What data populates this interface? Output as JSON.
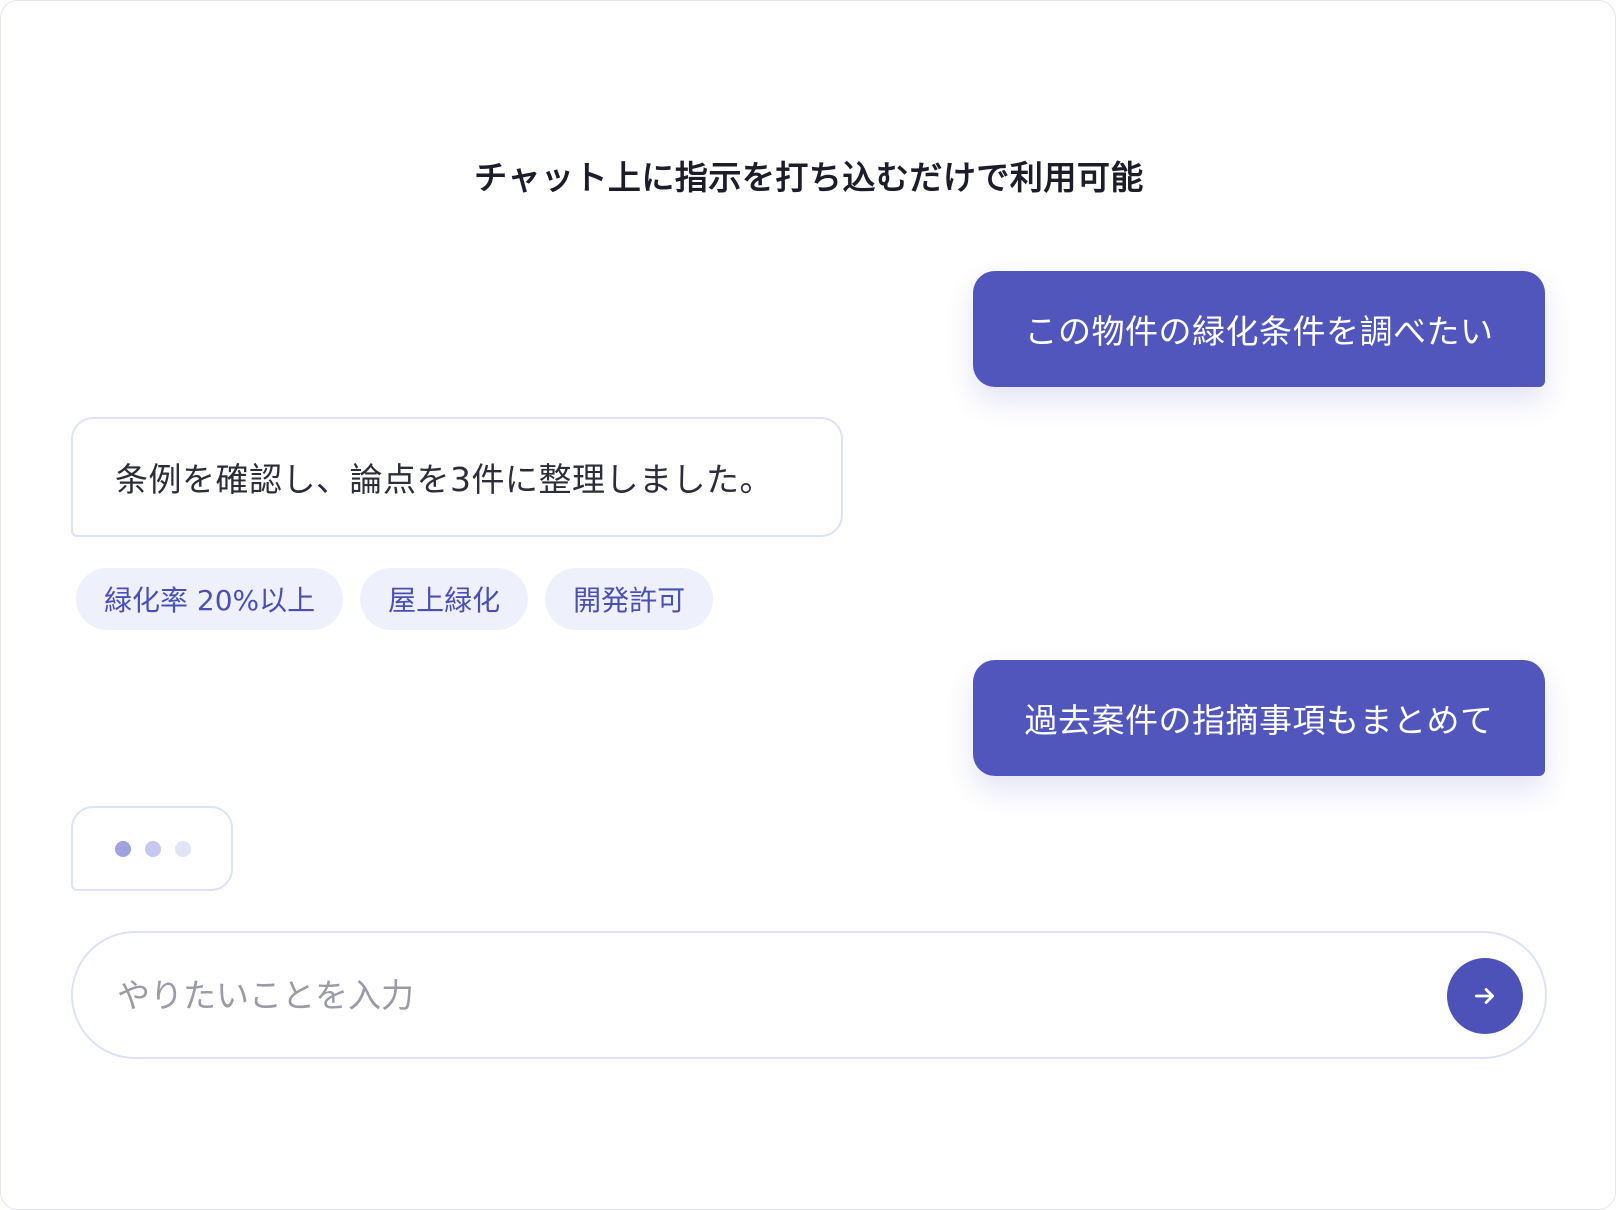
{
  "header": {
    "title": "チャット上に指示を打ち込むだけで利用可能"
  },
  "messages": [
    {
      "role": "user",
      "text": "この物件の緑化条件を調べたい"
    },
    {
      "role": "assistant",
      "text": "条例を確認し、論点を3件に整理しました。"
    },
    {
      "role": "user",
      "text": "過去案件の指摘事項もまとめて"
    }
  ],
  "tags": [
    {
      "label": "緑化率 20%以上"
    },
    {
      "label": "屋上緑化"
    },
    {
      "label": "開発許可"
    }
  ],
  "typing_indicator": {
    "icon": "typing-dots-icon"
  },
  "composer": {
    "placeholder": "やりたいことを入力",
    "value": "",
    "send_icon": "arrow-right-icon"
  },
  "colors": {
    "accent": "#5156bd",
    "tag_bg": "#eef0fb",
    "tag_text": "#4a4fb6",
    "border": "#dde3f6"
  }
}
